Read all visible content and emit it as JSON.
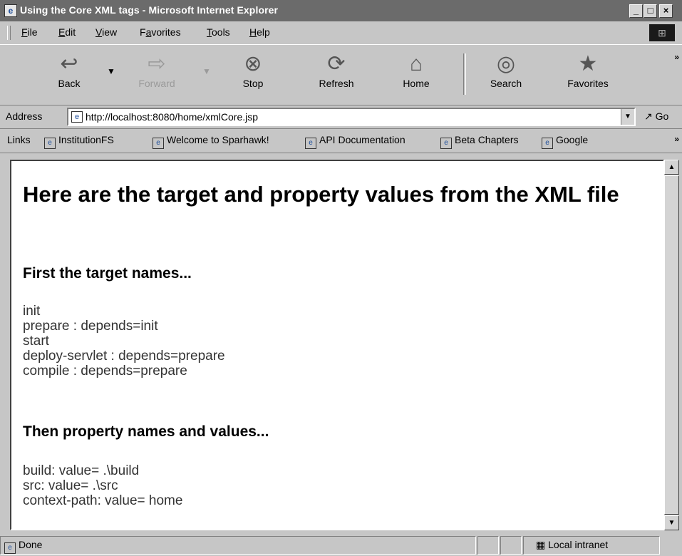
{
  "window": {
    "title": "Using the Core XML tags - Microsoft Internet Explorer"
  },
  "menu": [
    "File",
    "Edit",
    "View",
    "Favorites",
    "Tools",
    "Help"
  ],
  "menu_accel": [
    "F",
    "E",
    "V",
    "a",
    "T",
    "H"
  ],
  "toolbar": {
    "back": "Back",
    "forward": "Forward",
    "stop": "Stop",
    "refresh": "Refresh",
    "home": "Home",
    "search": "Search",
    "favorites": "Favorites"
  },
  "address": {
    "label": "Address",
    "url": "http://localhost:8080/home/xmlCore.jsp",
    "go": "Go"
  },
  "links": {
    "label": "Links",
    "items": [
      "InstitutionFS",
      "Welcome to Sparhawk!",
      "API Documentation",
      "Beta Chapters",
      "Google"
    ]
  },
  "page": {
    "heading": "Here are the target and property values from the XML file",
    "section1": "First the target names...",
    "targets": [
      "init",
      "prepare : depends=init",
      "start",
      "deploy-servlet : depends=prepare",
      "compile : depends=prepare"
    ],
    "section2": "Then property names and values...",
    "properties": [
      "build: value= .\\build",
      "src: value= .\\src",
      "context-path: value= home"
    ]
  },
  "status": {
    "text": "Done",
    "zone": "Local intranet"
  }
}
